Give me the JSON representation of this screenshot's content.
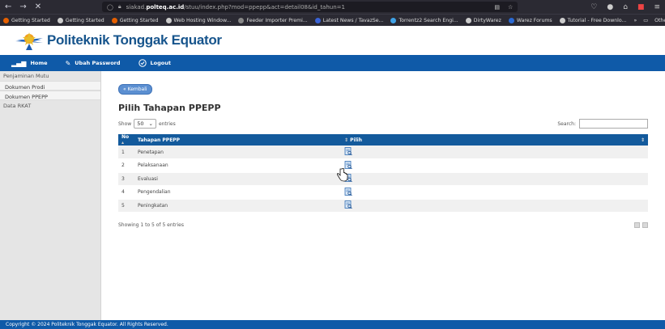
{
  "browser": {
    "url_prefix": "siakad.",
    "url_host": "polteq.ac.id",
    "url_path": "/stuu/index.php?mod=ppepp&act=detail08&id_tahun=1",
    "bookmarks": [
      {
        "label": "Getting Started",
        "color": "#e66000"
      },
      {
        "label": "Getting Started",
        "color": "#cccccc"
      },
      {
        "label": "Getting Started",
        "color": "#e66000"
      },
      {
        "label": "Web Hosting Window...",
        "color": "#cccccc"
      },
      {
        "label": "Feeder Importer Premi...",
        "color": "#888888"
      },
      {
        "label": "Latest News / TavazSe...",
        "color": "#3a63d6"
      },
      {
        "label": "Torrentz2 Search Engi...",
        "color": "#3fa2e6"
      },
      {
        "label": "DirtyWarez",
        "color": "#cccccc"
      },
      {
        "label": "Warez Forums",
        "color": "#2b6ad4"
      },
      {
        "label": "Tutorial - Free Downlo...",
        "color": "#cccccc"
      }
    ],
    "other_bookmarks": "Other Bookmarks"
  },
  "header": {
    "title": "Politeknik Tonggak Equator"
  },
  "nav": {
    "home": "Home",
    "change_password": "Ubah Password",
    "logout": "Logout"
  },
  "sidebar": {
    "heading": "Penjaminan Mutu",
    "items": [
      "Dokumen Prodi",
      "Dokumen PPEPP"
    ],
    "data_rkat": "Data RKAT"
  },
  "main": {
    "back_label": "« Kembali",
    "title": "Pilih Tahapan PPEPP",
    "show_label": "Show",
    "show_value": "50",
    "entries_label": "entries",
    "search_label": "Search:",
    "search_value": "",
    "columns": {
      "no": "No",
      "tahapan": "Tahapan PPEPP",
      "pilih": "Pilih"
    },
    "rows": [
      {
        "no": "1",
        "tahapan": "Penetapan"
      },
      {
        "no": "2",
        "tahapan": "Pelaksanaan"
      },
      {
        "no": "3",
        "tahapan": "Evaluasi"
      },
      {
        "no": "4",
        "tahapan": "Pengendalian"
      },
      {
        "no": "5",
        "tahapan": "Peningkatan"
      }
    ],
    "info": "Showing 1 to 5 of 5 entries"
  },
  "footer": {
    "text": "Copyright © 2024 Politeknik Tonggak Equator. All Rights Reserved."
  },
  "colors": {
    "brand_blue": "#0f5aa8",
    "table_header": "#135a9c",
    "title_blue": "#16548c"
  }
}
